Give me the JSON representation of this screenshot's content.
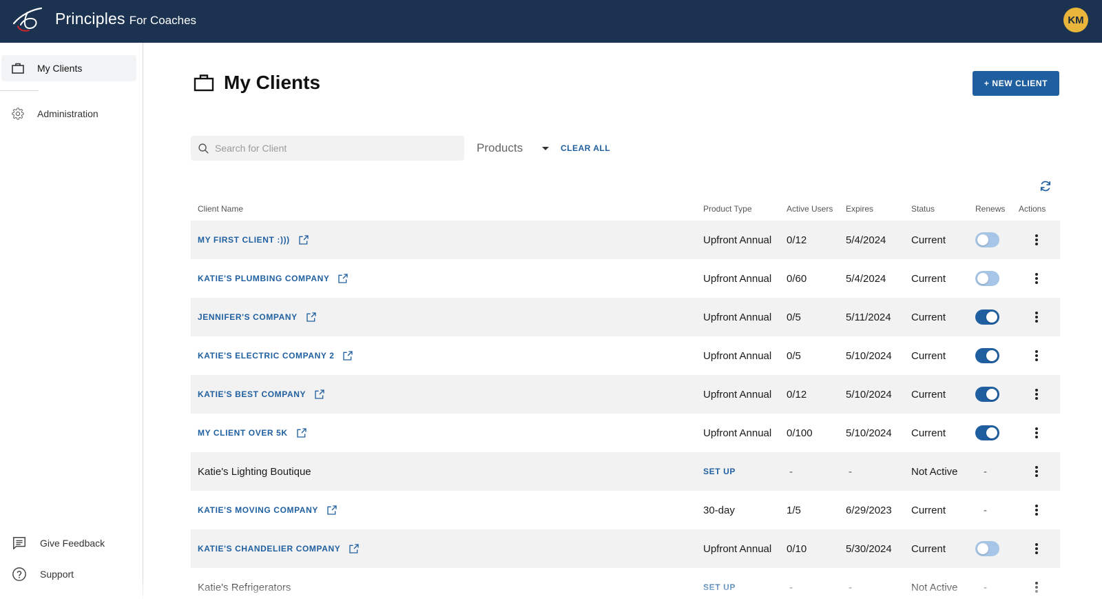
{
  "header": {
    "brand_main": "Principles",
    "brand_sub": "For Coaches",
    "avatar_initials": "KM",
    "background_color": "#1b3350",
    "avatar_color": "#e9b53b"
  },
  "sidebar": {
    "items": [
      {
        "label": "My Clients",
        "icon": "briefcase-icon",
        "active": true
      },
      {
        "label": "Administration",
        "icon": "gear-icon",
        "active": false
      }
    ],
    "bottom_items": [
      {
        "label": "Give Feedback",
        "icon": "feedback-icon"
      },
      {
        "label": "Support",
        "icon": "help-circle-icon"
      }
    ]
  },
  "main": {
    "title": "My Clients",
    "new_client_label": "+ NEW CLIENT",
    "search_placeholder": "Search for Client",
    "products_label": "Products",
    "clear_all_label": "CLEAR ALL",
    "accent_color": "#1f5f9f"
  },
  "table": {
    "columns": [
      "Client Name",
      "Product Type",
      "Active Users",
      "Expires",
      "Status",
      "Renews",
      "Actions"
    ],
    "rows": [
      {
        "name": "MY FIRST CLIENT :)))",
        "linked": true,
        "product": "Upfront Annual",
        "setup": false,
        "users": "0/12",
        "expires": "5/4/2024",
        "status": "Current",
        "renews": "off"
      },
      {
        "name": "KATIE'S PLUMBING COMPANY",
        "linked": true,
        "product": "Upfront Annual",
        "setup": false,
        "users": "0/60",
        "expires": "5/4/2024",
        "status": "Current",
        "renews": "off"
      },
      {
        "name": "JENNIFER'S COMPANY",
        "linked": true,
        "product": "Upfront Annual",
        "setup": false,
        "users": "0/5",
        "expires": "5/11/2024",
        "status": "Current",
        "renews": "on"
      },
      {
        "name": "KATIE'S ELECTRIC COMPANY 2",
        "linked": true,
        "product": "Upfront Annual",
        "setup": false,
        "users": "0/5",
        "expires": "5/10/2024",
        "status": "Current",
        "renews": "on"
      },
      {
        "name": "KATIE'S BEST COMPANY",
        "linked": true,
        "product": "Upfront Annual",
        "setup": false,
        "users": "0/12",
        "expires": "5/10/2024",
        "status": "Current",
        "renews": "on"
      },
      {
        "name": "MY CLIENT OVER 5K",
        "linked": true,
        "product": "Upfront Annual",
        "setup": false,
        "users": "0/100",
        "expires": "5/10/2024",
        "status": "Current",
        "renews": "on"
      },
      {
        "name": "Katie's Lighting Boutique",
        "linked": false,
        "product": "SET UP",
        "setup": true,
        "users": "-",
        "expires": "-",
        "status": "Not Active",
        "renews": "-"
      },
      {
        "name": "KATIE'S MOVING COMPANY",
        "linked": true,
        "product": "30-day",
        "setup": false,
        "users": "1/5",
        "expires": "6/29/2023",
        "status": "Current",
        "renews": "-"
      },
      {
        "name": "KATIE'S CHANDELIER COMPANY",
        "linked": true,
        "product": "Upfront Annual",
        "setup": false,
        "users": "0/10",
        "expires": "5/30/2024",
        "status": "Current",
        "renews": "off"
      },
      {
        "name": "Katie's Refrigerators",
        "linked": false,
        "product": "SET UP",
        "setup": true,
        "users": "-",
        "expires": "-",
        "status": "Not Active",
        "renews": "-"
      }
    ]
  }
}
